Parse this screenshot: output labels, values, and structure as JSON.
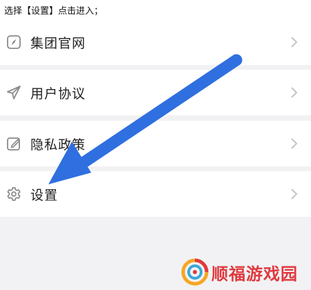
{
  "instruction": "选择【设置】点击进入；",
  "menu": [
    {
      "label": "集团官网",
      "icon": "compass-icon"
    },
    {
      "label": "用户协议",
      "icon": "send-icon"
    },
    {
      "label": "隐私政策",
      "icon": "edit-icon"
    },
    {
      "label": "设置",
      "icon": "gear-icon"
    }
  ],
  "watermark": {
    "text": "顺福游戏园"
  },
  "colors": {
    "background": "#f2f2f4",
    "row": "#ffffff",
    "icon": "#8a8a8a",
    "chevron": "#c4c4c4",
    "arrow": "#2f6fe0",
    "watermark_red": "#e0393e",
    "watermark_orange": "#f5a623"
  }
}
